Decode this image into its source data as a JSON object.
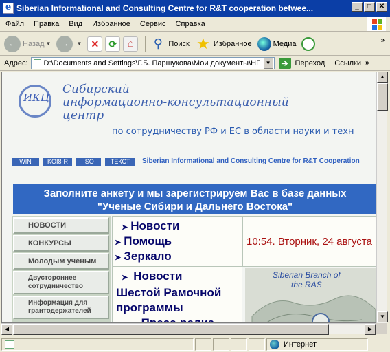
{
  "window": {
    "title": "Siberian Informational and Consulting Centre for R&T cooperation betwee...",
    "buttons": [
      "_",
      "□",
      "✕"
    ]
  },
  "menu": [
    "Файл",
    "Правка",
    "Вид",
    "Избранное",
    "Сервис",
    "Справка"
  ],
  "toolbar": {
    "back_label": "Назад",
    "search_label": "Поиск",
    "favorites_label": "Избранное",
    "media_label": "Медиа",
    "more": "»"
  },
  "address": {
    "label": "Адрес:",
    "value": "D:\\Documents and Settings\\Г.Б. Паршукова\\Мои документы\\НГ",
    "go_label": "Переход",
    "links_label": "Ссылки",
    "more": "»"
  },
  "page": {
    "logo_text": "ИКЦ",
    "org_name_line1": "Сибирский",
    "org_name_line2": "информационно-консультационный",
    "org_name_line3": "центр",
    "org_subtitle": "по сотрудничеству РФ и ЕС в области науки и техн",
    "encodings": [
      "WIN",
      "KOI8-R",
      "ISO",
      "ТЕКСТ"
    ],
    "english_name": "Siberian Informational and Consulting Centre for R&T Cooperation",
    "banner_line1": "Заполните анкету и мы зарегистрируем Вас в базе данных",
    "banner_line2": "\"Ученые Сибири и Дальнего Востока\"",
    "side_menu": [
      "НОВОСТИ",
      "КОНКУРСЫ",
      "Молодым ученым",
      "Двустороннее сотрудничество",
      "Информация для грантодержателей"
    ],
    "nav_links": [
      "Новости",
      "Помощь",
      "Зеркало"
    ],
    "clock": "10:54. Вторник, 24 августа",
    "news_heading": "Новости",
    "news_line2": "Шестой Рамочной",
    "news_line3": "программы",
    "news_line4": "Пресс-релиз",
    "map_caption_line1": "Siberian Branch of",
    "map_caption_line2": "the RAS"
  },
  "status": {
    "zone": "Интернет"
  },
  "colors": {
    "titlebar": "#0b3ea6",
    "banner": "#3168c2",
    "nav_link": "#06066a",
    "clock": "#aa1111"
  }
}
